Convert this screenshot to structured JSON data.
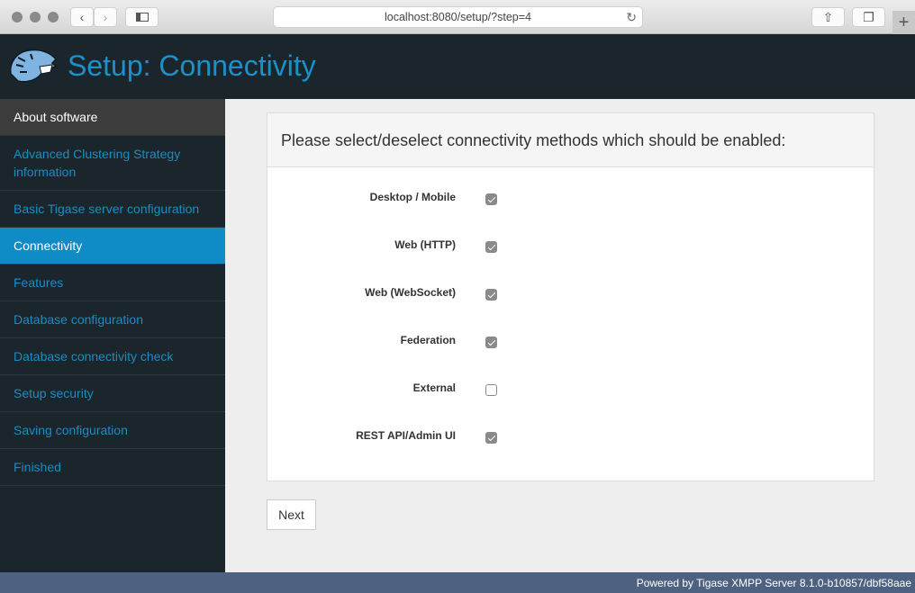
{
  "browser": {
    "url": "localhost:8080/setup/?step=4",
    "icons": [
      "back-icon",
      "forward-icon",
      "sidebar-icon",
      "reload-icon",
      "share-icon",
      "tabs-icon",
      "new-tab-icon"
    ]
  },
  "header": {
    "title": "Setup: Connectivity",
    "logo": "tiger-logo"
  },
  "sidebar": {
    "items": [
      {
        "label": "About software",
        "state": "info"
      },
      {
        "label": "Advanced Clustering Strategy information",
        "state": "normal"
      },
      {
        "label": "Basic Tigase server configuration",
        "state": "normal"
      },
      {
        "label": "Connectivity",
        "state": "active"
      },
      {
        "label": "Features",
        "state": "normal"
      },
      {
        "label": "Database configuration",
        "state": "normal"
      },
      {
        "label": "Database connectivity check",
        "state": "normal"
      },
      {
        "label": "Setup security",
        "state": "normal"
      },
      {
        "label": "Saving configuration",
        "state": "normal"
      },
      {
        "label": "Finished",
        "state": "normal"
      }
    ]
  },
  "panel": {
    "heading": "Please select/deselect connectivity methods which should be enabled:",
    "options": [
      {
        "label": "Desktop / Mobile",
        "checked": true
      },
      {
        "label": "Web (HTTP)",
        "checked": true
      },
      {
        "label": "Web (WebSocket)",
        "checked": true
      },
      {
        "label": "Federation",
        "checked": true
      },
      {
        "label": "External",
        "checked": false
      },
      {
        "label": "REST API/Admin UI",
        "checked": true
      }
    ]
  },
  "actions": {
    "next_label": "Next"
  },
  "footer": {
    "text": "Powered by Tigase XMPP Server 8.1.0-b10857/dbf58aae"
  }
}
